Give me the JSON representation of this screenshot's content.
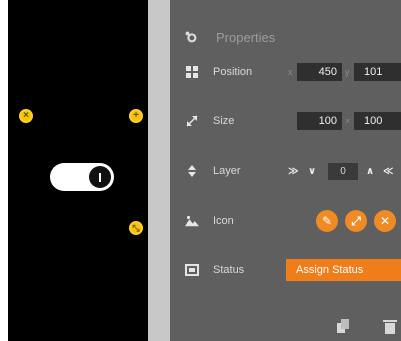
{
  "properties": {
    "title": "Properties",
    "position": {
      "label": "Position",
      "x_axis": "x",
      "x_value": "450",
      "y_axis": "y",
      "y_value": "101"
    },
    "size": {
      "label": "Size",
      "w_value": "100",
      "sep": "×",
      "h_value": "100"
    },
    "layer": {
      "label": "Layer",
      "value": "0"
    },
    "icon_row": {
      "label": "Icon"
    },
    "status": {
      "label": "Status",
      "button": "Assign Status"
    }
  },
  "icons": {
    "title": "gear-icon",
    "position": "position-icon",
    "size": "resize-icon",
    "layer": "layer-icon",
    "icon_row": "image-icon",
    "status": "status-icon",
    "edit": "pencil-icon",
    "expand": "expand-icon",
    "remove": "close-icon",
    "copy": "copy-icon",
    "trash": "trash-icon"
  },
  "colors": {
    "canvas": "#000000",
    "panel": "#5f5f5f",
    "accent": "#ee7d1a",
    "handle": "#f4c400"
  }
}
